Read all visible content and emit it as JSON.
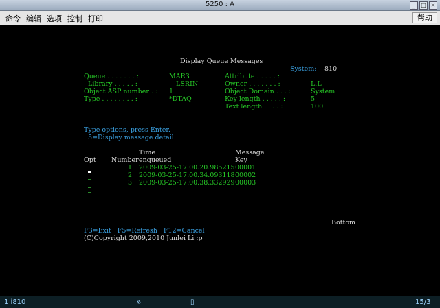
{
  "window": {
    "title": "5250 : A"
  },
  "menu": {
    "items": [
      "命令",
      "编辑",
      "选项",
      "控制",
      "打印"
    ],
    "help": "帮助"
  },
  "screen": {
    "heading": "Display Queue Messages",
    "system_label": "System:",
    "system_value": "810",
    "left_fields": [
      {
        "label": "Queue . . . . . . . :",
        "value": "MAR3"
      },
      {
        "label": "  Library . . . . . :",
        "value": "LSRIN"
      },
      {
        "label": "Object ASP number . :",
        "value": "1"
      },
      {
        "label": "Type . . . . . . . . :",
        "value": "*DTAQ"
      }
    ],
    "right_fields": [
      {
        "label": "Attribute . . . . . :",
        "value": ""
      },
      {
        "label": "Owner . . . . . . . :",
        "value": "L.L"
      },
      {
        "label": "Object Domain . . . :",
        "value": "System"
      },
      {
        "label": "Key length . . . . . :",
        "value": "5"
      },
      {
        "label": "Text length . . . . :",
        "value": "100"
      }
    ],
    "options_line": "Type options, press Enter.",
    "option_5": "  5=Display message detail",
    "col_time_top": "Time",
    "col_message_top": "Message",
    "col_opt": "Opt",
    "col_number": "Number",
    "col_enqueued": "enqueued",
    "col_key": "Key",
    "rows": [
      {
        "number": "1",
        "time": "2009-03-25-17.00.20.985215",
        "key": "00001"
      },
      {
        "number": "2",
        "time": "2009-03-25-17.00.34.093118",
        "key": "00002"
      },
      {
        "number": "3",
        "time": "2009-03-25-17.00.38.332929",
        "key": "00003"
      }
    ],
    "bottom_marker": "Bottom",
    "function_keys": "F3=Exit   F5=Refresh   F12=Cancel",
    "copyright": "(C)Copyright 2009,2010 Junlei Li :p"
  },
  "status": {
    "left": "1 i810",
    "middle_arrows": "»",
    "cursor_pos": "15/3"
  }
}
